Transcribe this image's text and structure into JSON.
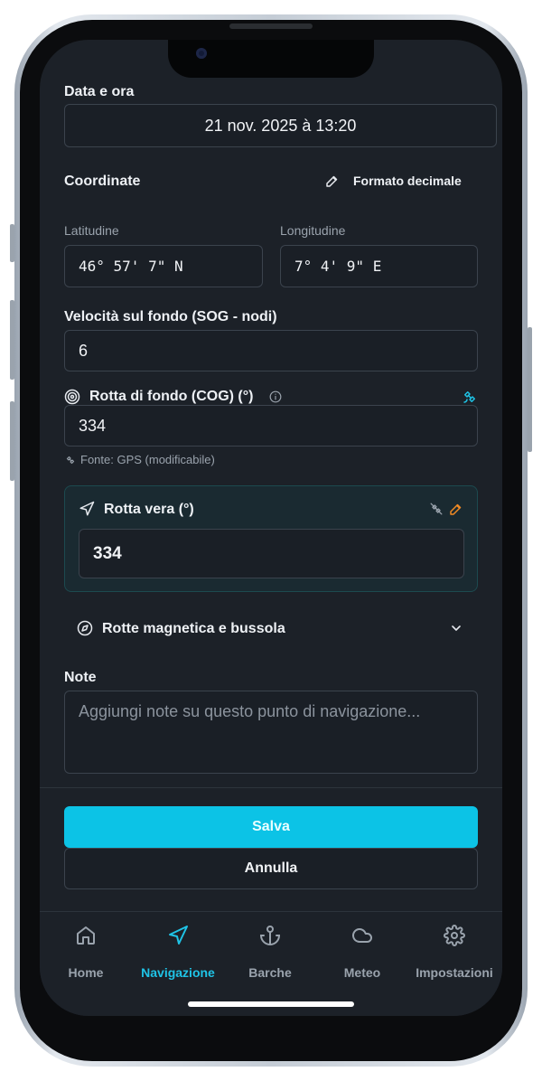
{
  "form": {
    "datetime_label": "Data e ora",
    "datetime_value": "21 nov. 2025 à 13:20",
    "coordinates_label": "Coordinate",
    "format_button": "Formato decimale",
    "latitude_label": "Latitudine",
    "latitude_value": "46° 57' 7\" N",
    "longitude_label": "Longitudine",
    "longitude_value": "7° 4' 9\" E",
    "sog_label": "Velocità sul fondo (SOG - nodi)",
    "sog_value": "6",
    "cog_label": "Rotta di fondo (COG) (°)",
    "cog_value": "334",
    "cog_source": "Fonte: GPS (modificabile)",
    "true_course_label": "Rotta vera (°)",
    "true_course_value": "334",
    "magnetic_label": "Rotte magnetica e bussola",
    "notes_label": "Note",
    "notes_placeholder": "Aggiungi note su questo punto di navigazione..."
  },
  "actions": {
    "save": "Salva",
    "cancel": "Annulla"
  },
  "tabs": [
    {
      "label": "Home",
      "icon": "home-icon"
    },
    {
      "label": "Navigazione",
      "icon": "navigation-arrow-icon",
      "active": true
    },
    {
      "label": "Barche",
      "icon": "anchor-icon"
    },
    {
      "label": "Meteo",
      "icon": "cloud-icon"
    },
    {
      "label": "Impostazioni",
      "icon": "gear-icon"
    }
  ],
  "colors": {
    "accent": "#0cc3e6",
    "background": "#1c2128",
    "edit_orange": "#f08a24"
  }
}
